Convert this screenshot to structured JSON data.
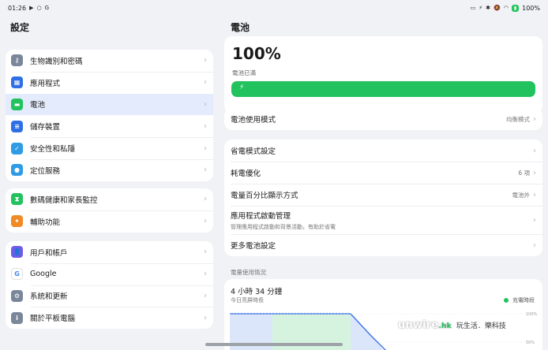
{
  "status_bar": {
    "time": "01:26",
    "battery_level": "100%"
  },
  "left": {
    "title": "設定",
    "groups": [
      [
        {
          "label": "生物識別和密碼",
          "icon": "key-icon",
          "color": "#7a8699"
        },
        {
          "label": "應用程式",
          "icon": "grid-icon",
          "color": "#2f6fe5"
        },
        {
          "label": "電池",
          "icon": "battery-icon",
          "color": "#22c25f"
        },
        {
          "label": "儲存裝置",
          "icon": "storage-icon",
          "color": "#2f6fe5"
        },
        {
          "label": "安全性和私隱",
          "icon": "shield-icon",
          "color": "#2f9be5"
        },
        {
          "label": "定位服務",
          "icon": "location-icon",
          "color": "#2f9be5"
        }
      ],
      [
        {
          "label": "數碼健康和家長監控",
          "icon": "hourglass-icon",
          "color": "#22c25f"
        },
        {
          "label": "輔助功能",
          "icon": "accessibility-icon",
          "color": "#f08a24"
        }
      ],
      [
        {
          "label": "用戶和帳戶",
          "icon": "user-icon",
          "color": "#6c5ce7"
        },
        {
          "label": "Google",
          "icon": "google-icon",
          "color": "#ffffff"
        },
        {
          "label": "系統和更新",
          "icon": "gear-icon",
          "color": "#7a8699"
        },
        {
          "label": "關於平板電腦",
          "icon": "info-icon",
          "color": "#7a8699"
        }
      ]
    ]
  },
  "right": {
    "title": "電池",
    "battery": {
      "percent": "100%",
      "status": "電池已滿",
      "fill": 1.0
    },
    "mode": {
      "label": "電池使用模式",
      "value": "均衡模式"
    },
    "settings": [
      {
        "label": "省電模式設定",
        "value": ""
      },
      {
        "label": "耗電優化",
        "value": "6 項"
      },
      {
        "label": "電量百分比顯示方式",
        "value": "電池外"
      },
      {
        "label": "應用程式啟動管理",
        "sub": "管理應用程式啟動和背景活動，有助於省電",
        "value": ""
      },
      {
        "label": "更多電池設定",
        "value": ""
      }
    ],
    "usage_section": "電量使用情況",
    "usage": {
      "duration": "4 小時 34 分鐘",
      "subtitle": "今日亮屏時長",
      "legend": "充電時段",
      "ticks": [
        "100%",
        "50%"
      ]
    }
  },
  "watermark": {
    "brand": "unwire",
    "brand_suffix": ".hk",
    "tagline": "玩生活．樂科技"
  }
}
